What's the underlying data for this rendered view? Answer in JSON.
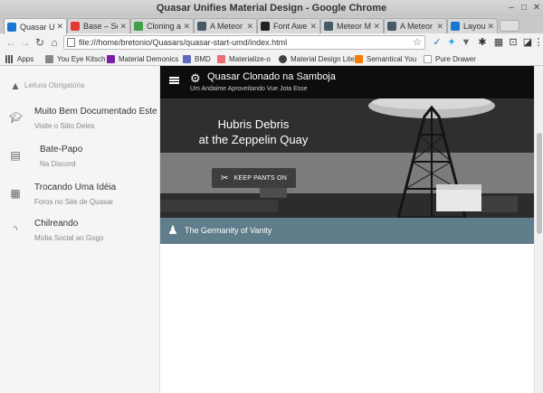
{
  "window": {
    "title": "Quasar Unifies Material Design - Google Chrome"
  },
  "tabs": [
    {
      "label": "Quasar Un",
      "favicon_color": "#1976d2",
      "active": true
    },
    {
      "label": "Base – Se",
      "favicon_color": "#e53935",
      "active": false
    },
    {
      "label": "Cloning a",
      "favicon_color": "#43a047",
      "active": false
    },
    {
      "label": "A Meteor",
      "favicon_color": "#455a64",
      "active": false
    },
    {
      "label": "Font Awe",
      "favicon_color": "#212121",
      "active": false
    },
    {
      "label": "Meteor Ma",
      "favicon_color": "#455a64",
      "active": false
    },
    {
      "label": "A Meteor",
      "favicon_color": "#455a64",
      "active": false
    },
    {
      "label": "Layout - Q",
      "favicon_color": "#1976d2",
      "active": false
    }
  ],
  "address": {
    "url": "file:///home/bretonio/Quasars/quasar-start-umd/index.html"
  },
  "bookmarks": [
    {
      "label": "Apps",
      "color": "#555555"
    },
    {
      "label": "You Eye Kitsch",
      "color": "#888888"
    },
    {
      "label": "Material Demonics",
      "color": "#7b1fa2"
    },
    {
      "label": "BMD",
      "color": "#5c6bc0"
    },
    {
      "label": "Materialize-o",
      "color": "#ee6e73"
    },
    {
      "label": "Material Design Lite",
      "color": "#424242"
    },
    {
      "label": "Semantical You",
      "color": "#f57c00"
    },
    {
      "label": "Pure Drawer",
      "color": "#9e9e9e"
    }
  ],
  "drawer": {
    "items": [
      {
        "title": "Leitura Obrigatória",
        "subtitle": "",
        "icon": "book-icon"
      },
      {
        "title": "Muito Bem Documentado Este",
        "subtitle": "Visite o Sitio Deles",
        "icon": "school-icon"
      },
      {
        "title": "Bate-Papo",
        "subtitle": "Na Discord",
        "icon": "chat-icon"
      },
      {
        "title": "Trocando Uma Idéia",
        "subtitle": "Foros no Site de Quasar",
        "icon": "forum-icon"
      },
      {
        "title": "Chilreando",
        "subtitle": "Mídia Social ao Gogo",
        "icon": "rss-icon"
      }
    ]
  },
  "header": {
    "title": "Quasar Clonado na Samboja",
    "subtitle": "Um Andaime Aproveitando Vue Jota Esse"
  },
  "hero": {
    "title_line1": "Hubris Debris",
    "title_line2": "at the Zeppelin Quay",
    "button_label": "KEEP PANTS ON"
  },
  "caption": {
    "text": "The Germanity of Vanity"
  }
}
